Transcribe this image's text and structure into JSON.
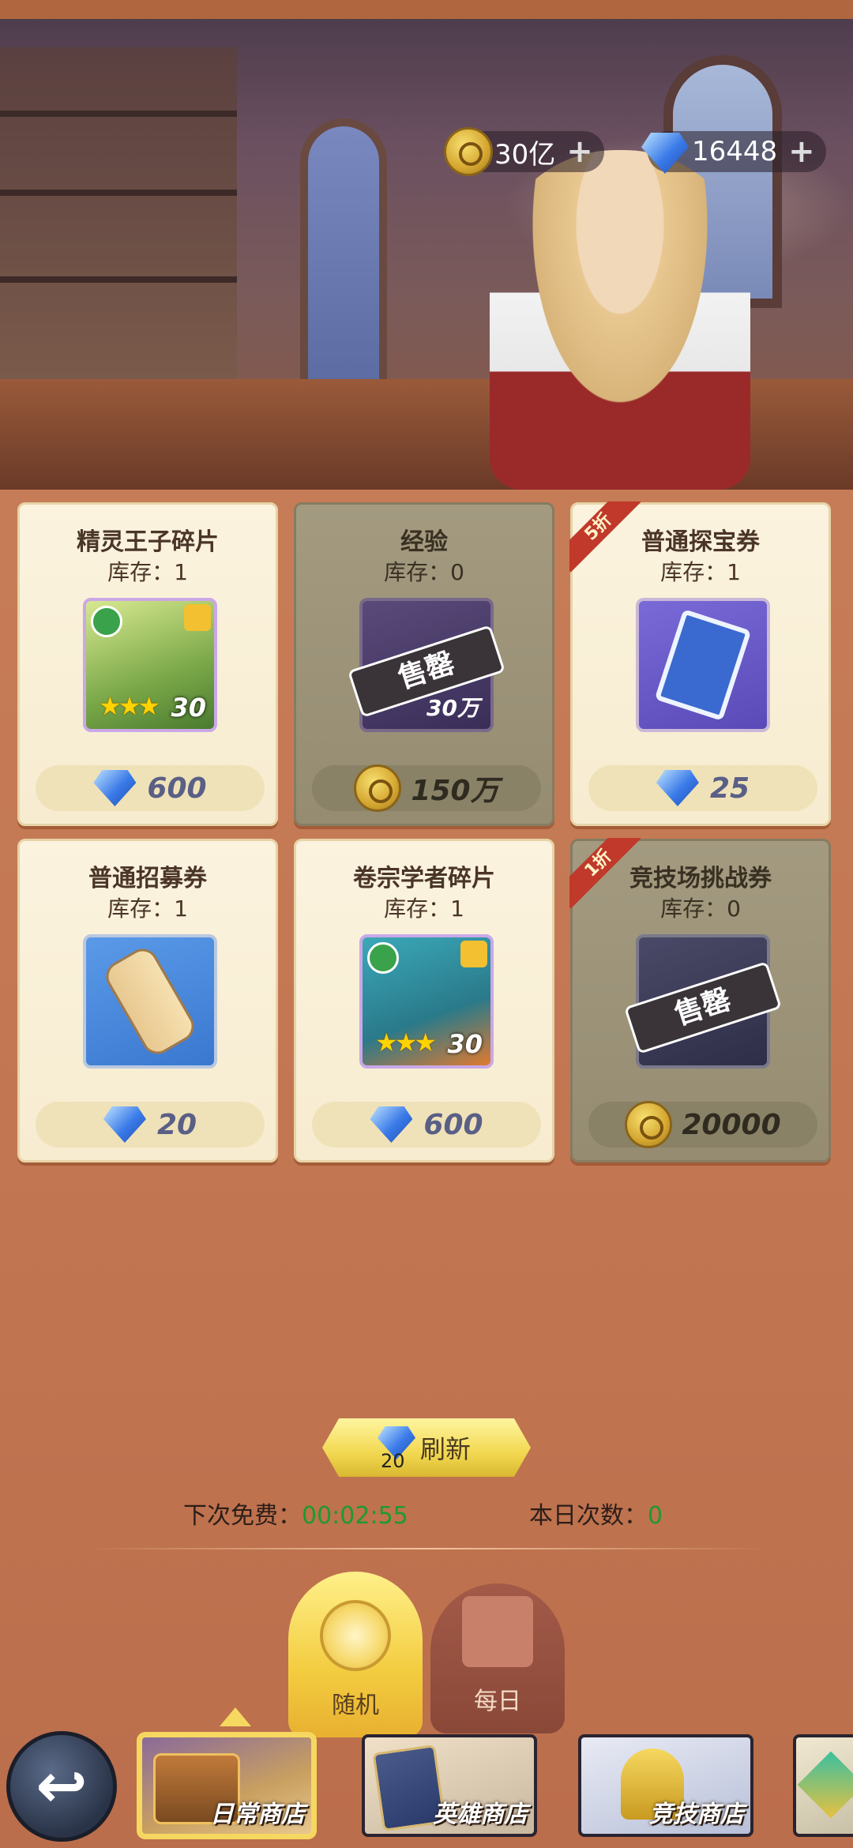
{
  "currency": {
    "coins": "30亿",
    "gems": "16448"
  },
  "cards": [
    {
      "title": "精灵王子碎片",
      "stock": "库存：1",
      "price": "600",
      "price_type": "gem",
      "sold_out": false,
      "badge": "",
      "stars": "★★★",
      "level": "30"
    },
    {
      "title": "经验",
      "stock": "库存：0",
      "price": "150万",
      "price_type": "coin",
      "sold_out": true,
      "badge": "",
      "amount": "30万",
      "stamp": "售罄"
    },
    {
      "title": "普通探宝券",
      "stock": "库存：1",
      "price": "25",
      "price_type": "gem",
      "sold_out": false,
      "badge": "5折"
    },
    {
      "title": "普通招募券",
      "stock": "库存：1",
      "price": "20",
      "price_type": "gem",
      "sold_out": false,
      "badge": ""
    },
    {
      "title": "卷宗学者碎片",
      "stock": "库存：1",
      "price": "600",
      "price_type": "gem",
      "sold_out": false,
      "badge": "",
      "stars": "★★★",
      "level": "30"
    },
    {
      "title": "竞技场挑战券",
      "stock": "库存：0",
      "price": "20000",
      "price_type": "coin",
      "sold_out": true,
      "badge": "1折",
      "stamp": "售罄"
    }
  ],
  "refresh": {
    "label": "刷新",
    "cost": "20"
  },
  "free": {
    "next_free_label": "下次免费：",
    "next_free_time": "00:02:55",
    "today_count_label": "本日次数：",
    "today_count": "0"
  },
  "subtabs": {
    "random": "随机",
    "daily": "每日"
  },
  "shops": {
    "daily": "日常商店",
    "hero": "英雄商店",
    "arena": "竞技商店"
  },
  "colors": {
    "background": "#c47954",
    "card_bg": "#fbf3de",
    "price_text": "#5a5f86",
    "timer_green": "#1e9a2e",
    "badge_red": "#c0392b"
  }
}
